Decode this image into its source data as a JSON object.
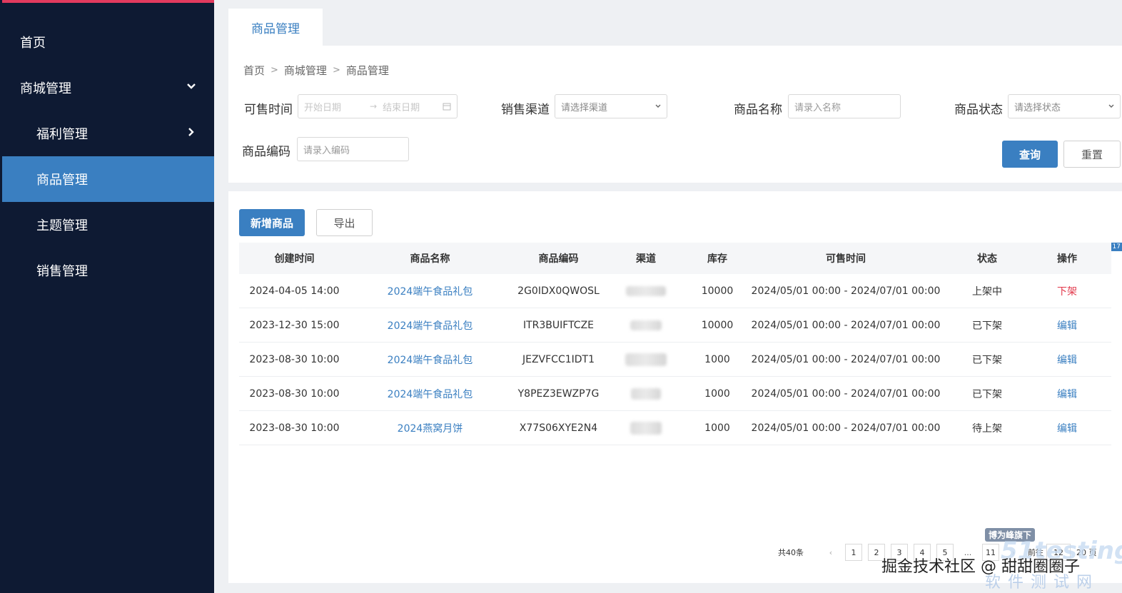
{
  "sidebar": {
    "items": [
      {
        "label": "首页"
      },
      {
        "label": "商城管理"
      },
      {
        "label": "福利管理"
      },
      {
        "label": "商品管理"
      },
      {
        "label": "主题管理"
      },
      {
        "label": "销售管理"
      }
    ]
  },
  "tabs": [
    {
      "label": "商品管理"
    }
  ],
  "breadcrumb": [
    "首页",
    "商城管理",
    "商品管理"
  ],
  "filters": {
    "sale_time": {
      "label": "可售时间",
      "start_placeholder": "开始日期",
      "end_placeholder": "结束日期"
    },
    "channel": {
      "label": "销售渠道",
      "placeholder": "请选择渠道"
    },
    "name": {
      "label": "商品名称",
      "placeholder": "请录入名称"
    },
    "status": {
      "label": "商品状态",
      "placeholder": "请选择状态"
    },
    "code": {
      "label": "商品编码",
      "placeholder": "请录入编码"
    },
    "search_label": "查询",
    "reset_label": "重置"
  },
  "toolbar": {
    "add_label": "新增商品",
    "export_label": "导出"
  },
  "table": {
    "columns": [
      "创建时间",
      "商品名称",
      "商品编码",
      "渠道",
      "库存",
      "可售时间",
      "状态",
      "操作"
    ],
    "rows": [
      {
        "created": "2024-04-05 14:00",
        "name": "2024端午食品礼包",
        "code": "2G0IDX0QWOSL",
        "stock": "10000",
        "sale_time": "2024/05/01 00:00 - 2024/07/01 00:00",
        "status": "上架中",
        "action": "下架"
      },
      {
        "created": "2023-12-30 15:00",
        "name": "2024端午食品礼包",
        "code": "ITR3BUIFTCZE",
        "stock": "10000",
        "sale_time": "2024/05/01 00:00 - 2024/07/01 00:00",
        "status": "已下架",
        "action": "编辑"
      },
      {
        "created": "2023-08-30 10:00",
        "name": "2024端午食品礼包",
        "code": "JEZVFCC1IDT1",
        "stock": "1000",
        "sale_time": "2024/05/01 00:00 - 2024/07/01 00:00",
        "status": "已下架",
        "action": "编辑"
      },
      {
        "created": "2023-08-30 10:00",
        "name": "2024端午食品礼包",
        "code": "Y8PEZ3EWZP7G",
        "stock": "1000",
        "sale_time": "2024/05/01 00:00 - 2024/07/01 00:00",
        "status": "已下架",
        "action": "编辑"
      },
      {
        "created": "2023-08-30 10:00",
        "name": "2024燕窝月饼",
        "code": "X77S06XYE2N4",
        "stock": "1000",
        "sale_time": "2024/05/01 00:00 - 2024/07/01 00:00",
        "status": "待上架",
        "action": "编辑"
      }
    ]
  },
  "pagination": {
    "total": "共40条",
    "pages": [
      "1",
      "2",
      "3",
      "4",
      "5",
      "...",
      "11"
    ],
    "goto_prefix": "前往",
    "goto_value": "12",
    "goto_suffix": "20 页"
  },
  "corner_badge": "17",
  "watermark": {
    "badge": "博为峰旗下",
    "logo": "51testing",
    "text": "掘金技术社区 @ 甜甜圈圈子",
    "sub": "软件测试网"
  },
  "colors": {
    "sidebar_bg": "#0e1a33",
    "accent": "#3a7fc1",
    "danger": "#e2374a",
    "top_stripe": "#e23a5e"
  }
}
